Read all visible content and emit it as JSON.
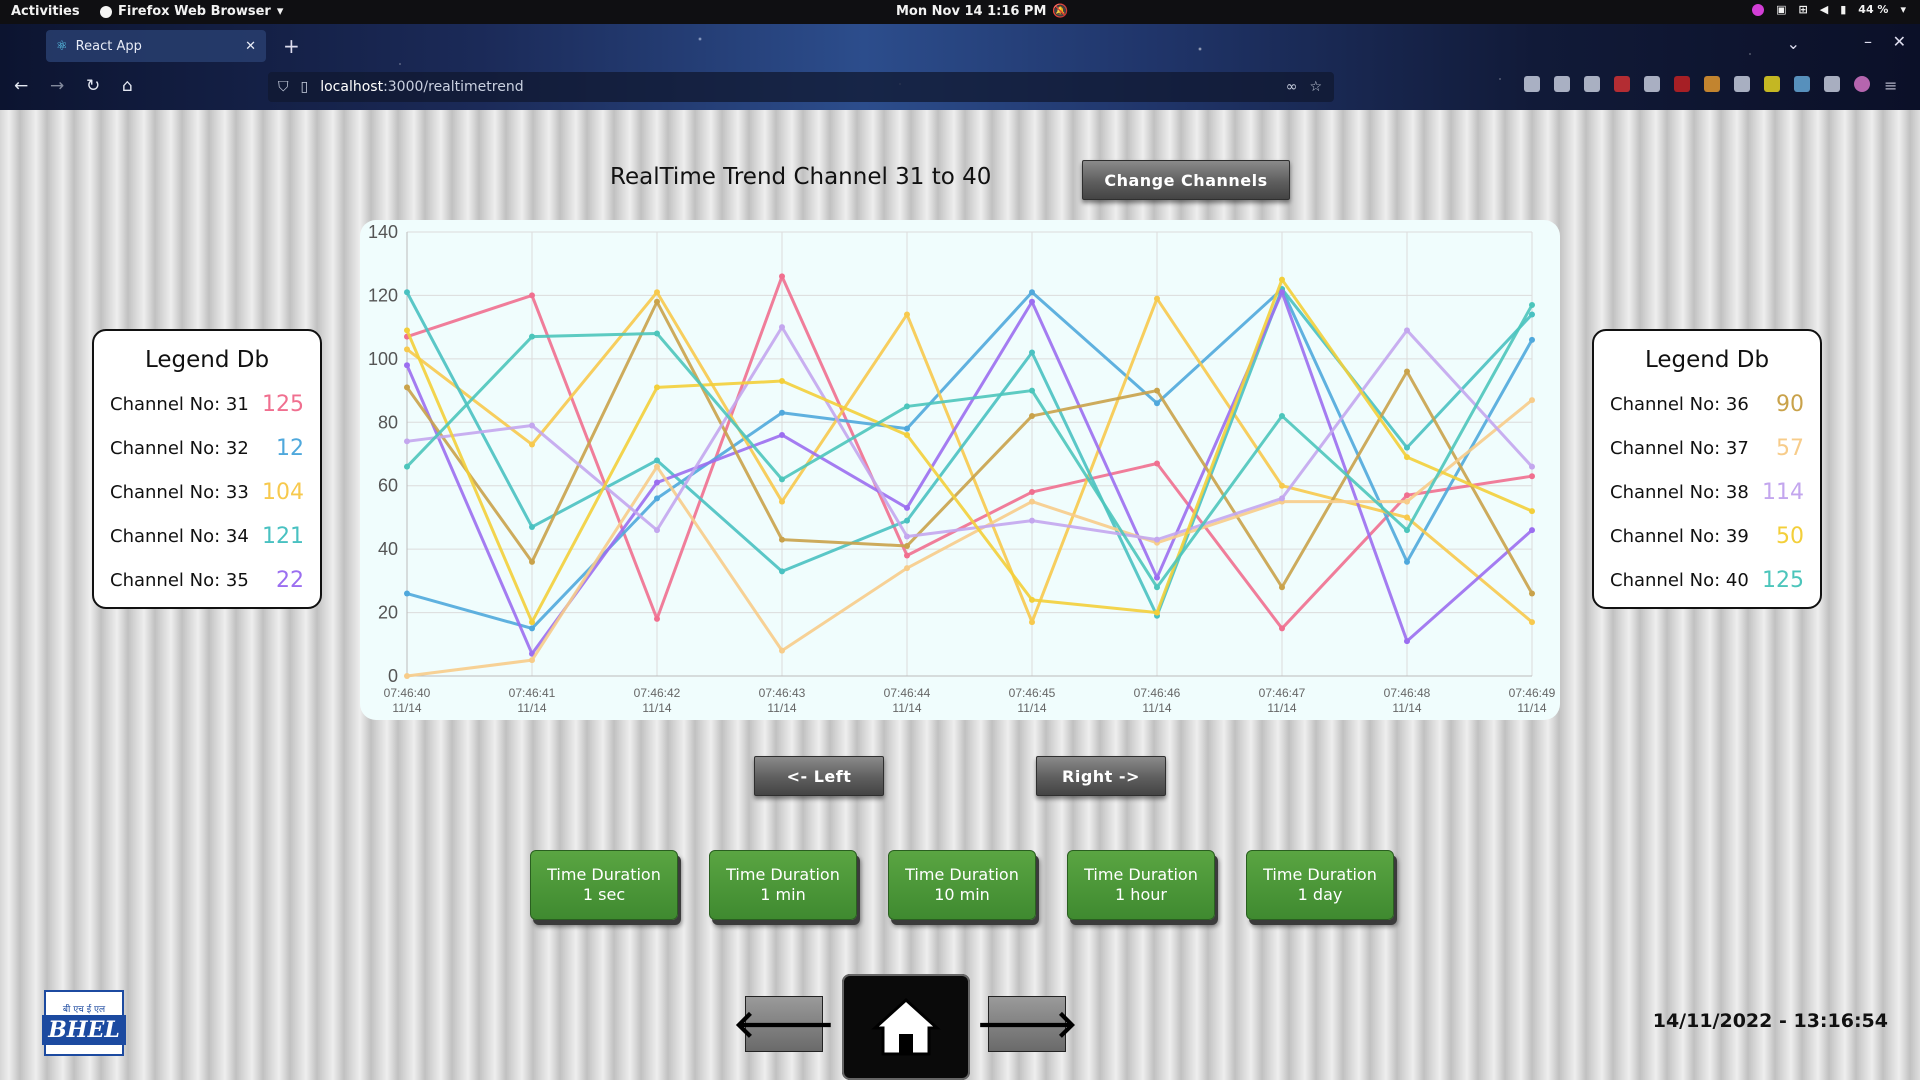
{
  "topbar": {
    "activities": "Activities",
    "app_menu": "Firefox Web Browser",
    "clock": "Mon Nov 14  1:16 PM",
    "battery": "44 %"
  },
  "browser": {
    "tab_title": "React App",
    "url_host": "localhost",
    "url_rest": ":3000/realtimetrend"
  },
  "page": {
    "title": "RealTime Trend Channel 31 to 40",
    "change_channels": "Change Channels",
    "left_label": "<- Left",
    "right_label": "Right ->",
    "datetime": "14/11/2022 - 13:16:54",
    "logo_top": "बी एच ई एल",
    "logo_text": "BHEL"
  },
  "legend_left": {
    "title": "Legend Db",
    "rows": [
      {
        "label": "Channel No: 31",
        "value": "125",
        "color": "#f06f8f"
      },
      {
        "label": "Channel No: 32",
        "value": "12",
        "color": "#4fa8dc"
      },
      {
        "label": "Channel No: 33",
        "value": "104",
        "color": "#f7c94d"
      },
      {
        "label": "Channel No: 34",
        "value": "121",
        "color": "#49c1c1"
      },
      {
        "label": "Channel No: 35",
        "value": "22",
        "color": "#9b6ef0"
      }
    ]
  },
  "legend_right": {
    "title": "Legend Db",
    "rows": [
      {
        "label": "Channel No: 36",
        "value": "90",
        "color": "#c9a24a"
      },
      {
        "label": "Channel No: 37",
        "value": "57",
        "color": "#f7cc8a"
      },
      {
        "label": "Channel No: 38",
        "value": "114",
        "color": "#c3a6ee"
      },
      {
        "label": "Channel No: 39",
        "value": "50",
        "color": "#f3cf3a"
      },
      {
        "label": "Channel No: 40",
        "value": "125",
        "color": "#4cc5bb"
      }
    ]
  },
  "time_buttons": [
    {
      "line1": "Time Duration",
      "line2": "1 sec"
    },
    {
      "line1": "Time Duration",
      "line2": "1 min"
    },
    {
      "line1": "Time Duration",
      "line2": "10 min"
    },
    {
      "line1": "Time Duration",
      "line2": "1 hour"
    },
    {
      "line1": "Time Duration",
      "line2": "1 day"
    }
  ],
  "chart_data": {
    "type": "line",
    "title": "",
    "xlabel": "",
    "ylabel": "",
    "ylim": [
      0,
      140
    ],
    "yticks": [
      0,
      20,
      40,
      60,
      80,
      100,
      120,
      140
    ],
    "grid": true,
    "categories": [
      "07:46:40",
      "07:46:41",
      "07:46:42",
      "07:46:43",
      "07:46:44",
      "07:46:45",
      "07:46:46",
      "07:46:47",
      "07:46:48",
      "07:46:49"
    ],
    "category_dates": [
      "11/14",
      "11/14",
      "11/14",
      "11/14",
      "11/14",
      "11/14",
      "11/14",
      "11/14",
      "11/14",
      "11/14"
    ],
    "series": [
      {
        "color": "#f06f8f",
        "values": [
          107,
          120,
          18,
          126,
          38,
          58,
          67,
          15,
          57,
          63
        ]
      },
      {
        "color": "#4fa8dc",
        "values": [
          26,
          15,
          56,
          83,
          78,
          121,
          86,
          122,
          36,
          106
        ]
      },
      {
        "color": "#f7c94d",
        "values": [
          103,
          73,
          121,
          55,
          114,
          17,
          119,
          60,
          50,
          17
        ]
      },
      {
        "color": "#49c1c1",
        "values": [
          121,
          47,
          68,
          33,
          49,
          102,
          19,
          122,
          72,
          114
        ]
      },
      {
        "color": "#9b6ef0",
        "values": [
          98,
          7,
          61,
          76,
          53,
          118,
          31,
          121,
          11,
          46
        ]
      },
      {
        "color": "#c9a24a",
        "values": [
          91,
          36,
          118,
          43,
          41,
          82,
          90,
          28,
          96,
          26
        ]
      },
      {
        "color": "#f7cc8a",
        "values": [
          0,
          5,
          66,
          8,
          34,
          55,
          42,
          55,
          55,
          87
        ]
      },
      {
        "color": "#c3a6ee",
        "values": [
          74,
          79,
          46,
          110,
          44,
          49,
          43,
          56,
          109,
          66
        ]
      },
      {
        "color": "#f3cf3a",
        "values": [
          109,
          17,
          91,
          93,
          76,
          24,
          20,
          125,
          69,
          52
        ]
      },
      {
        "color": "#4cc5bb",
        "values": [
          66,
          107,
          108,
          62,
          85,
          90,
          28,
          82,
          46,
          117
        ]
      }
    ]
  }
}
